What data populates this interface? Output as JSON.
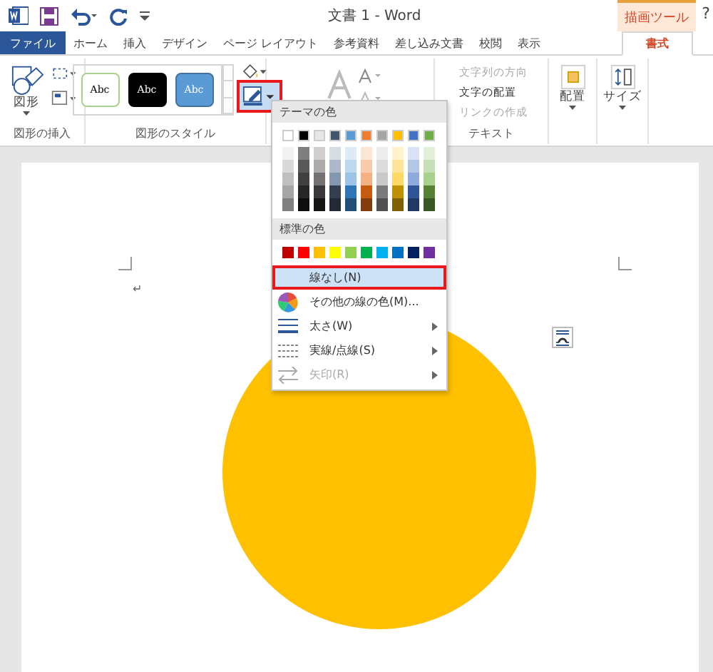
{
  "title_bar": {
    "title": "文書 1 - Word",
    "context_tab": "描画ツール",
    "help": "?"
  },
  "tabs": [
    {
      "label": "ファイル",
      "kind": "file",
      "selected": false
    },
    {
      "label": "ホーム",
      "kind": "tab",
      "selected": false
    },
    {
      "label": "挿入",
      "kind": "tab",
      "selected": false
    },
    {
      "label": "デザイン",
      "kind": "tab",
      "selected": false
    },
    {
      "label": "ページ レイアウト",
      "kind": "tab",
      "selected": false
    },
    {
      "label": "参考資料",
      "kind": "tab",
      "selected": false
    },
    {
      "label": "差し込み文書",
      "kind": "tab",
      "selected": false
    },
    {
      "label": "校閲",
      "kind": "tab",
      "selected": false
    },
    {
      "label": "表示",
      "kind": "tab",
      "selected": false
    },
    {
      "label": "書式",
      "kind": "context",
      "selected": true
    }
  ],
  "ribbon": {
    "insert_group": {
      "shapes_label": "図形",
      "label": "図形の挿入"
    },
    "style_group": {
      "styles": [
        {
          "label": "Abc",
          "kind": "outline"
        },
        {
          "label": "Abc",
          "kind": "dark"
        },
        {
          "label": "Abc",
          "kind": "blue"
        }
      ],
      "outline_button_open": true,
      "label": "図形のスタイル"
    },
    "text_group": {
      "items": [
        {
          "label": "文字列の方向",
          "disabled": true
        },
        {
          "label": "文字の配置",
          "disabled": false
        },
        {
          "label": "リンクの作成",
          "disabled": true
        }
      ],
      "label": "テキスト"
    },
    "arrange": {
      "label": "配置"
    },
    "size": {
      "label": "サイズ"
    }
  },
  "outline_menu": {
    "theme_header": "テーマの色",
    "theme_colors": [
      {
        "color": "#ffffff",
        "shades": [
          {
            "color": "#f2f2f2"
          },
          {
            "color": "#d9d9d9"
          },
          {
            "color": "#bfbfbf"
          },
          {
            "color": "#a6a6a6"
          },
          {
            "color": "#808080"
          }
        ]
      },
      {
        "color": "#000000",
        "shades": [
          {
            "color": "#7f7f7f"
          },
          {
            "color": "#595959"
          },
          {
            "color": "#404040"
          },
          {
            "color": "#262626"
          },
          {
            "color": "#0d0d0d"
          }
        ]
      },
      {
        "color": "#e7e6e6",
        "shades": [
          {
            "color": "#d0cece"
          },
          {
            "color": "#aeabab"
          },
          {
            "color": "#757171"
          },
          {
            "color": "#3a3838"
          },
          {
            "color": "#171616"
          }
        ]
      },
      {
        "color": "#44546a",
        "shades": [
          {
            "color": "#d6dce4"
          },
          {
            "color": "#adb9ca"
          },
          {
            "color": "#8497b0"
          },
          {
            "color": "#333f4f"
          },
          {
            "color": "#222a35"
          }
        ]
      },
      {
        "color": "#5b9bd5",
        "shades": [
          {
            "color": "#deebf6"
          },
          {
            "color": "#bdd7ee"
          },
          {
            "color": "#9dc3e6"
          },
          {
            "color": "#2e75b5"
          },
          {
            "color": "#1f4e79"
          }
        ]
      },
      {
        "color": "#ed7d31",
        "shades": [
          {
            "color": "#fbe5d5"
          },
          {
            "color": "#f8cbad"
          },
          {
            "color": "#f4b183"
          },
          {
            "color": "#c55a11"
          },
          {
            "color": "#833c0b"
          }
        ]
      },
      {
        "color": "#a5a5a5",
        "shades": [
          {
            "color": "#ededed"
          },
          {
            "color": "#dbdbdb"
          },
          {
            "color": "#c9c9c9"
          },
          {
            "color": "#7b7b7b"
          },
          {
            "color": "#525252"
          }
        ]
      },
      {
        "color": "#ffc000",
        "shades": [
          {
            "color": "#fff2cc"
          },
          {
            "color": "#fee599"
          },
          {
            "color": "#ffd965"
          },
          {
            "color": "#bf9000"
          },
          {
            "color": "#7f6000"
          }
        ]
      },
      {
        "color": "#4472c4",
        "shades": [
          {
            "color": "#dae3f3"
          },
          {
            "color": "#b4c7e7"
          },
          {
            "color": "#8faadc"
          },
          {
            "color": "#2f5597"
          },
          {
            "color": "#203864"
          }
        ]
      },
      {
        "color": "#70ad47",
        "shades": [
          {
            "color": "#e2f0d9"
          },
          {
            "color": "#c5e0b4"
          },
          {
            "color": "#a9d18e"
          },
          {
            "color": "#548235"
          },
          {
            "color": "#385723"
          }
        ]
      }
    ],
    "standard_header": "標準の色",
    "standard_colors": [
      {
        "color": "#c00000"
      },
      {
        "color": "#ff0000"
      },
      {
        "color": "#ffc000"
      },
      {
        "color": "#ffff00"
      },
      {
        "color": "#92d050"
      },
      {
        "color": "#00b050"
      },
      {
        "color": "#00b0f0"
      },
      {
        "color": "#0070c0"
      },
      {
        "color": "#002060"
      },
      {
        "color": "#7030a0"
      }
    ],
    "items": [
      {
        "label": "線なし(N)",
        "kind": "none",
        "selected": true,
        "disabled": false,
        "submenu": false
      },
      {
        "label": "その他の線の色(M)...",
        "kind": "palette",
        "selected": false,
        "disabled": false,
        "submenu": false
      },
      {
        "label": "太さ(W)",
        "kind": "weight",
        "selected": false,
        "disabled": false,
        "submenu": true
      },
      {
        "label": "実線/点線(S)",
        "kind": "dash",
        "selected": false,
        "disabled": false,
        "submenu": true
      },
      {
        "label": "矢印(R)",
        "kind": "arrow",
        "selected": false,
        "disabled": true,
        "submenu": true
      }
    ]
  },
  "document": {
    "paragraph_mark": "↵",
    "shape": {
      "color": "#ffc000"
    }
  }
}
